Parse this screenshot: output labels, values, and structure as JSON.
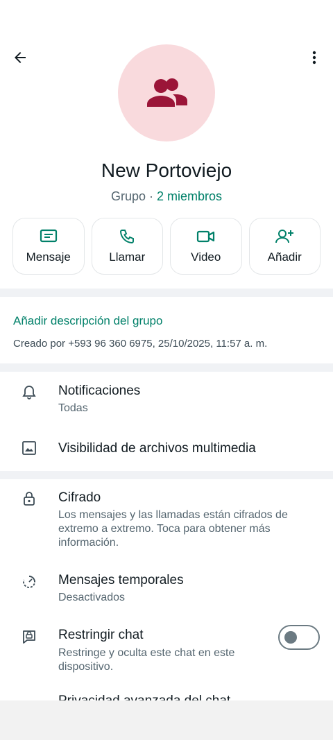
{
  "group": {
    "name": "New Portoviejo",
    "type_label": "Grupo ·",
    "members_label": "2 miembros"
  },
  "actions": [
    {
      "label": "Mensaje",
      "icon": "message-icon"
    },
    {
      "label": "Llamar",
      "icon": "phone-icon"
    },
    {
      "label": "Video",
      "icon": "video-icon"
    },
    {
      "label": "Añadir",
      "icon": "add-person-icon"
    }
  ],
  "description": {
    "add_label": "Añadir descripción del grupo",
    "created_text": "Creado por +593 96 360 6975, 25/10/2025, 11:57 a. m."
  },
  "settings": {
    "notifications": {
      "title": "Notificaciones",
      "subtitle": "Todas"
    },
    "media_visibility": {
      "title": "Visibilidad de archivos multimedia"
    },
    "encryption": {
      "title": "Cifrado",
      "subtitle": "Los mensajes y las llamadas están cifrados de extremo a extremo. Toca para obtener más información."
    },
    "disappearing": {
      "title": "Mensajes temporales",
      "subtitle": "Desactivados"
    },
    "restrict": {
      "title": "Restringir chat",
      "subtitle": "Restringe y oculta este chat en este dispositivo.",
      "enabled": false
    },
    "privacy_cut": {
      "title": "Privacidad avanzada del chat"
    }
  },
  "colors": {
    "accent": "#008069",
    "avatar_bg": "#f9dadd",
    "avatar_fg": "#9b1538"
  }
}
